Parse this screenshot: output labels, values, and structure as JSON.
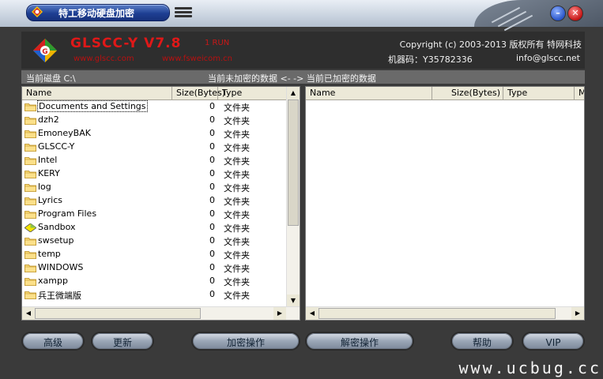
{
  "titlebar": {
    "title": "特工移动硬盘加密"
  },
  "header": {
    "product": "GLSCC-Y V7.8",
    "run_label": "1 RUN",
    "site1": "www.glscc.com",
    "site2": "www.fsweicom.cn",
    "copyright": "Copyright (c) 2003-2013 版权所有 特网科技",
    "machine_code": "机器码：Y35782336",
    "email": "info@glscc.net"
  },
  "status": {
    "current_disk": "当前磁盘 C:\\",
    "flow": "当前未加密的数据 <- -> 当前已加密的数据"
  },
  "left_pane": {
    "columns": [
      "Name",
      "Size(Bytes)",
      "Type"
    ],
    "rows": [
      {
        "name": "Documents and Settings",
        "size": "0",
        "type": "文件夹",
        "icon": "folder-icon"
      },
      {
        "name": "dzh2",
        "size": "0",
        "type": "文件夹",
        "icon": "folder-icon"
      },
      {
        "name": "EmoneyBAK",
        "size": "0",
        "type": "文件夹",
        "icon": "folder-icon"
      },
      {
        "name": "GLSCC-Y",
        "size": "0",
        "type": "文件夹",
        "icon": "folder-icon"
      },
      {
        "name": "Intel",
        "size": "0",
        "type": "文件夹",
        "icon": "folder-icon"
      },
      {
        "name": "KERY",
        "size": "0",
        "type": "文件夹",
        "icon": "folder-icon"
      },
      {
        "name": "log",
        "size": "0",
        "type": "文件夹",
        "icon": "folder-icon"
      },
      {
        "name": "Lyrics",
        "size": "0",
        "type": "文件夹",
        "icon": "folder-icon"
      },
      {
        "name": "Program Files",
        "size": "0",
        "type": "文件夹",
        "icon": "folder-icon"
      },
      {
        "name": "Sandbox",
        "size": "0",
        "type": "文件夹",
        "icon": "sandbox-icon"
      },
      {
        "name": "swsetup",
        "size": "0",
        "type": "文件夹",
        "icon": "folder-icon"
      },
      {
        "name": "temp",
        "size": "0",
        "type": "文件夹",
        "icon": "folder-icon"
      },
      {
        "name": "WINDOWS",
        "size": "0",
        "type": "文件夹",
        "icon": "folder-icon"
      },
      {
        "name": "xampp",
        "size": "0",
        "type": "文件夹",
        "icon": "folder-icon"
      },
      {
        "name": "兵王微端版",
        "size": "0",
        "type": "文件夹",
        "icon": "folder-icon"
      }
    ]
  },
  "right_pane": {
    "columns": [
      "Name",
      "Size(Bytes)",
      "Type",
      "M"
    ]
  },
  "buttons": {
    "advanced": "高级",
    "update": "更新",
    "encrypt": "加密操作",
    "decrypt": "解密操作",
    "help": "帮助",
    "vip": "VIP"
  },
  "watermark": "www.ucbug.cc",
  "colors": {
    "window_bg": "#3a3a3a",
    "brand_red": "#e01818",
    "title_blue": "#1e3f93",
    "button_gray": "#9aa6b6"
  }
}
